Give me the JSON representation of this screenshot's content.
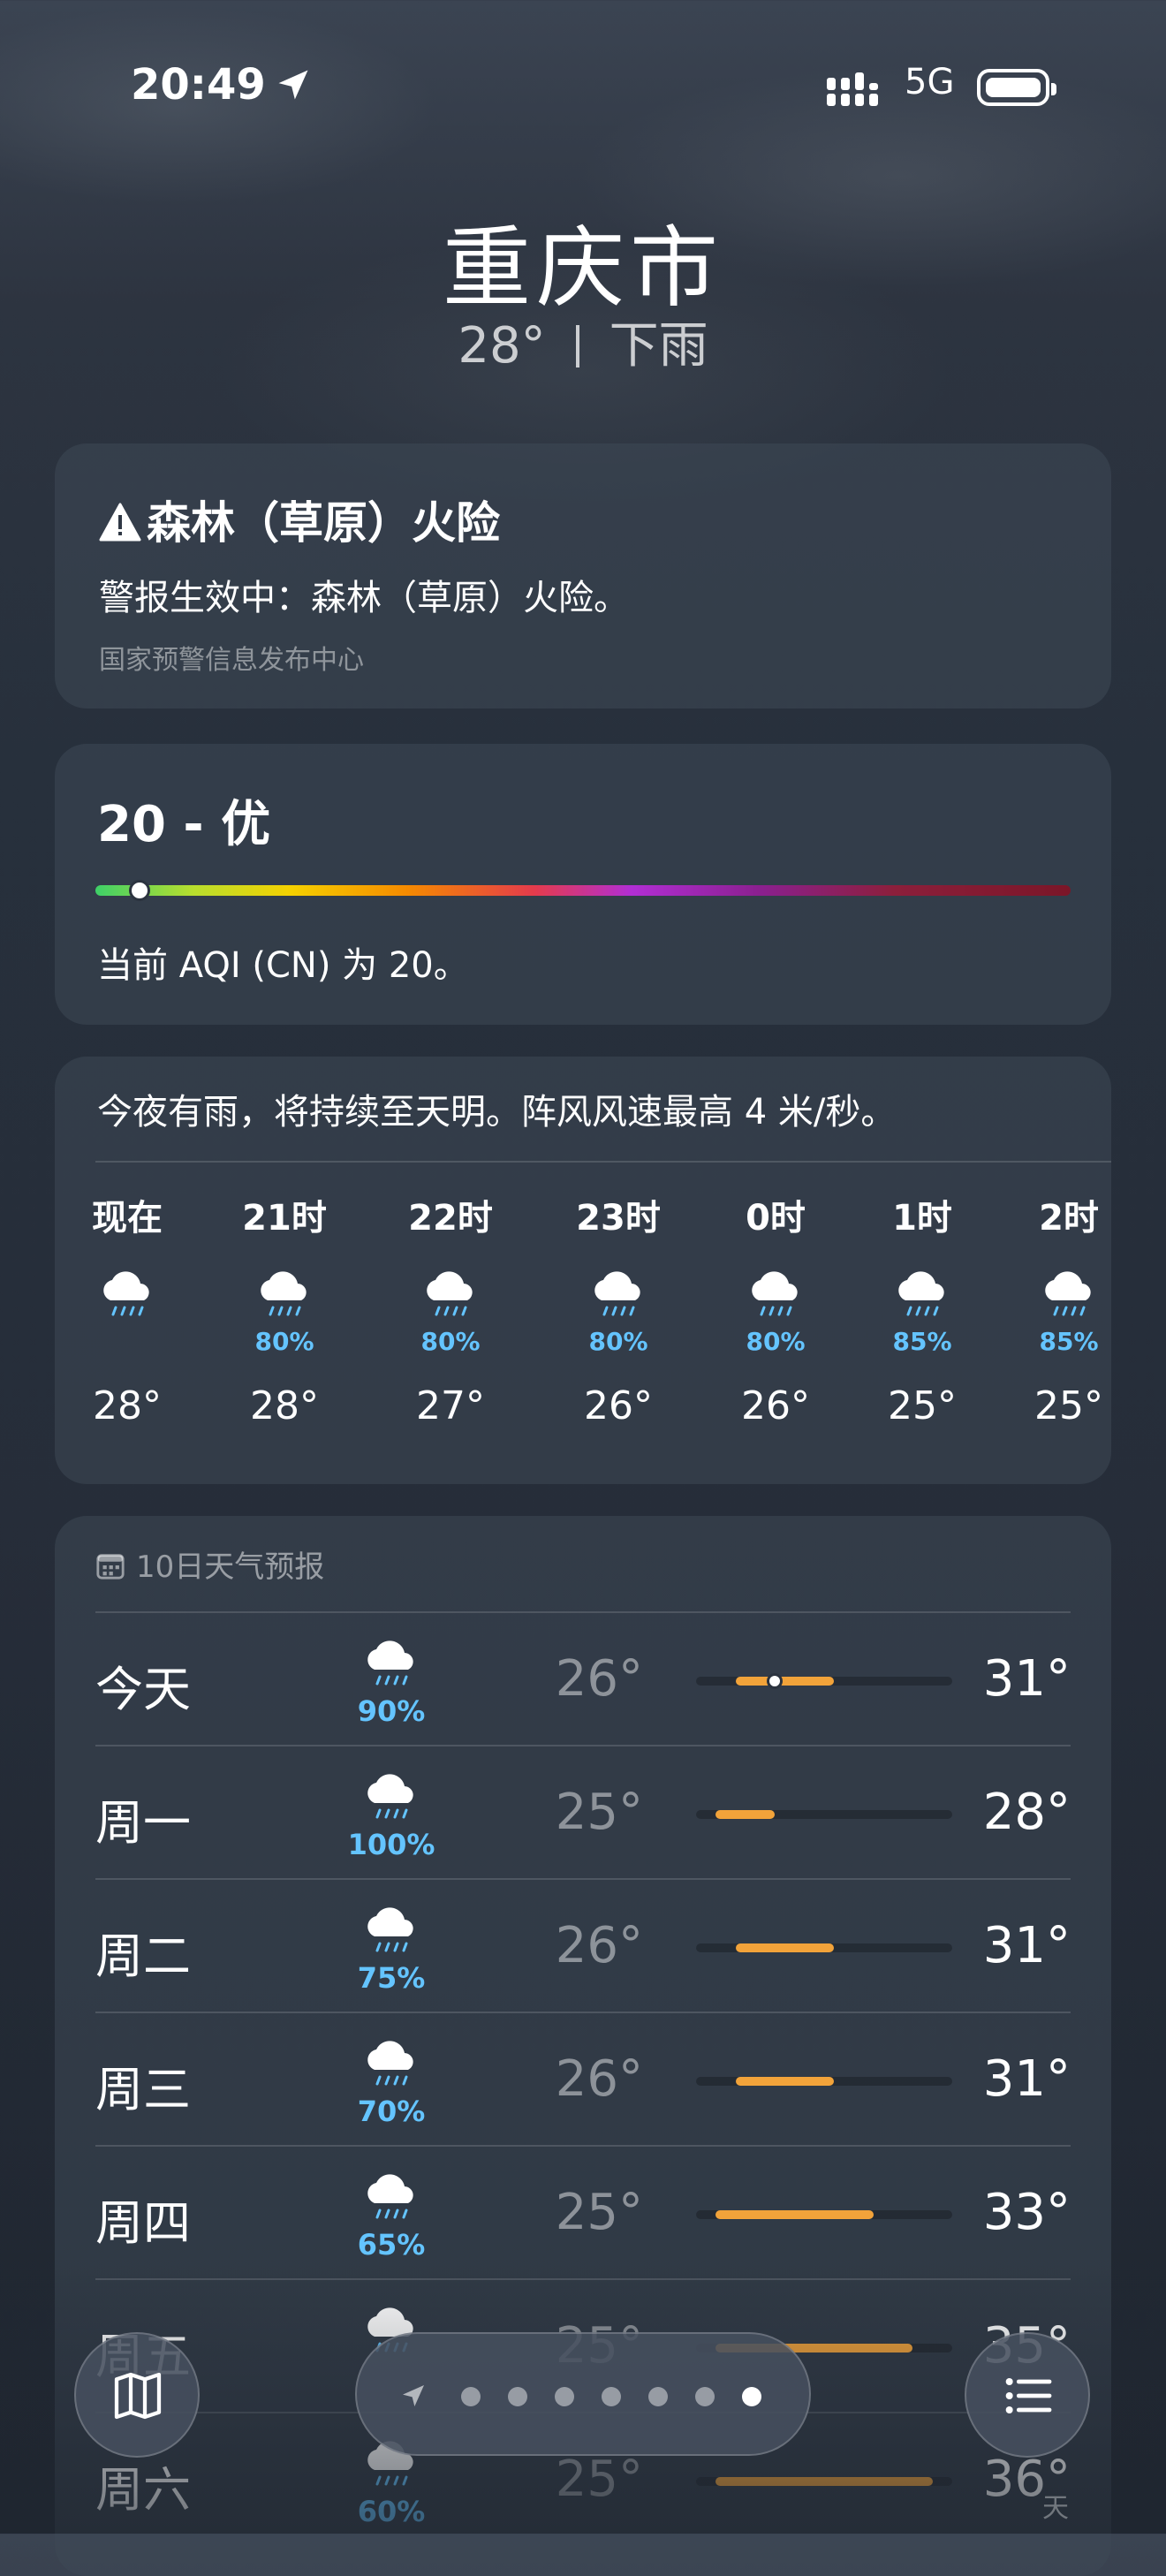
{
  "status_bar": {
    "time": "20:49",
    "network": "5G"
  },
  "header": {
    "city": "重庆市",
    "temperature": "28°",
    "condition": "下雨"
  },
  "alert": {
    "title": "森林（草原）火险",
    "text": "警报生效中：森林（草原）火险。",
    "source": "国家预警信息发布中心"
  },
  "aqi": {
    "value_label": "20 - 优",
    "text": "当前 AQI (CN) 为 20。",
    "index_fraction": 0.045
  },
  "hourly": {
    "summary": "今夜有雨，将持续至天明。阵风风速最高 4 米/秒。",
    "items": [
      {
        "label": "现在",
        "precip": "",
        "temp": "28°"
      },
      {
        "label": "21时",
        "precip": "80%",
        "temp": "28°"
      },
      {
        "label": "22时",
        "precip": "80%",
        "temp": "27°"
      },
      {
        "label": "23时",
        "precip": "80%",
        "temp": "26°"
      },
      {
        "label": "0时",
        "precip": "80%",
        "temp": "26°"
      },
      {
        "label": "1时",
        "precip": "85%",
        "temp": "25°"
      },
      {
        "label": "2时",
        "precip": "85%",
        "temp": "25°"
      }
    ]
  },
  "daily": {
    "header": "10日天气预报",
    "days": [
      {
        "day": "今天",
        "precip": "90%",
        "low": "26°",
        "high": "31°",
        "low_num": 26,
        "high_num": 31,
        "current": 28
      },
      {
        "day": "周一",
        "precip": "100%",
        "low": "25°",
        "high": "28°",
        "low_num": 25,
        "high_num": 28
      },
      {
        "day": "周二",
        "precip": "75%",
        "low": "26°",
        "high": "31°",
        "low_num": 26,
        "high_num": 31
      },
      {
        "day": "周三",
        "precip": "70%",
        "low": "26°",
        "high": "31°",
        "low_num": 26,
        "high_num": 31
      },
      {
        "day": "周四",
        "precip": "65%",
        "low": "25°",
        "high": "33°",
        "low_num": 25,
        "high_num": 33
      },
      {
        "day": "周五",
        "precip": "",
        "low": "25°",
        "high": "35°",
        "low_num": 25,
        "high_num": 35
      },
      {
        "day": "周六",
        "precip": "60%",
        "low": "25°",
        "high": "36°",
        "low_num": 25,
        "high_num": 36
      }
    ],
    "scale_min": 24,
    "scale_max": 37
  },
  "pager": {
    "page_count": 7,
    "active_index": 6
  },
  "watermark": "天"
}
